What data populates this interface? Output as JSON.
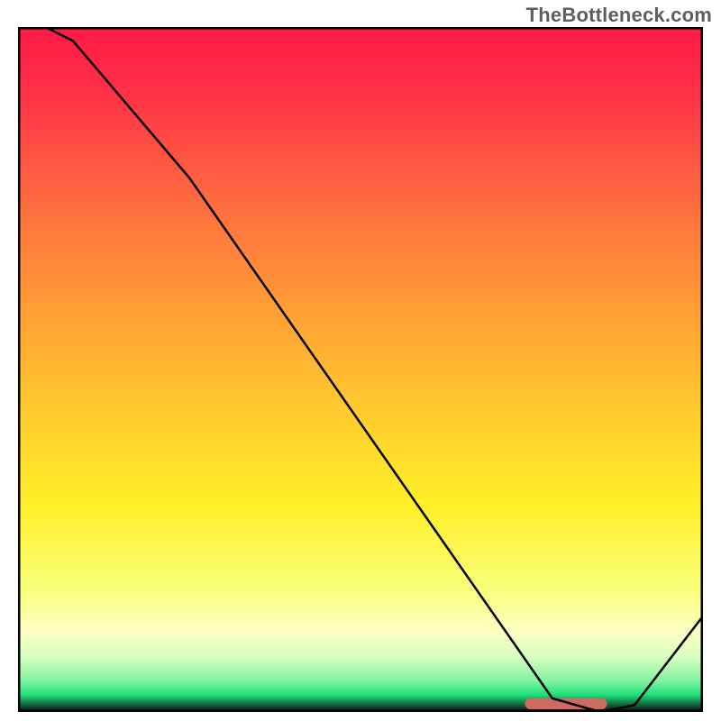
{
  "watermark": "TheBottleneck.com",
  "chart_data": {
    "type": "line",
    "title": "",
    "xlabel": "",
    "ylabel": "",
    "xlim": [
      0,
      100
    ],
    "ylim": [
      0,
      100
    ],
    "grid": false,
    "legend": false,
    "series": [
      {
        "name": "bottleneck-curve",
        "x": [
          0,
          8,
          25,
          78,
          85,
          90,
          100
        ],
        "y": [
          102,
          98,
          78,
          2,
          0,
          1,
          14
        ],
        "stroke": "#000000",
        "stroke_width": 2.5
      }
    ],
    "markers": [
      {
        "name": "sweet-spot",
        "shape": "rounded-bar",
        "x": 80,
        "y": 1.2,
        "width_x": 12,
        "height_y": 1.6,
        "fill": "#cf6a63"
      }
    ],
    "background_gradient": {
      "type": "vertical",
      "stops": [
        {
          "offset": 0.0,
          "color": "#ff1a45"
        },
        {
          "offset": 0.1,
          "color": "#ff3247"
        },
        {
          "offset": 0.25,
          "color": "#ff6a3f"
        },
        {
          "offset": 0.4,
          "color": "#ff9a36"
        },
        {
          "offset": 0.55,
          "color": "#ffc82e"
        },
        {
          "offset": 0.7,
          "color": "#fff028"
        },
        {
          "offset": 0.82,
          "color": "#f8ff7a"
        },
        {
          "offset": 0.88,
          "color": "#fdffc0"
        },
        {
          "offset": 0.92,
          "color": "#d8ffc0"
        },
        {
          "offset": 0.955,
          "color": "#7ff2a0"
        },
        {
          "offset": 0.975,
          "color": "#1ee07a"
        },
        {
          "offset": 1.0,
          "color": "#0a0a0a"
        }
      ]
    },
    "frame": {
      "stroke": "#000000",
      "stroke_width": 5
    }
  }
}
